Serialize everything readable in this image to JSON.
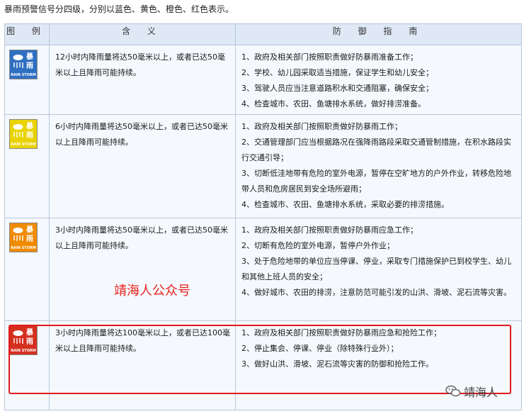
{
  "intro": "暴雨预警信号分四级，分别以蓝色、黄色、橙色、红色表示。",
  "headers": {
    "icon": "图 例",
    "meaning": "含 义",
    "guide": "防 御 指 南"
  },
  "rows": [
    {
      "level": "blue",
      "sign": {
        "chars": "暴雨",
        "en": "RAIN STORM",
        "color": "#2f6fc2"
      },
      "meaning": "12小时内降雨量将达50毫米以上，或者已达50毫米以上且降雨可能持续。",
      "guide": [
        "1、政府及相关部门按照职责做好防暴雨准备工作；",
        "2、学校、幼儿园采取适当措施，保证学生和幼儿安全；",
        "3、驾驶人员应当注意道路积水和交通阻塞，确保安全；",
        "4、检查城市、农田、鱼塘排水系统，做好排涝准备。"
      ]
    },
    {
      "level": "yellow",
      "sign": {
        "chars": "暴雨",
        "en": "RAIN STORM",
        "color": "#e9d300"
      },
      "meaning": "6小时内降雨量将达50毫米以上，或者已达50毫米以上且降雨可能持续。",
      "guide": [
        "1、政府及相关部门按照职责做好防暴雨工作；",
        "2、交通管理部门应当根据路况在强降雨路段采取交通管制措施，在积水路段实行交通引导；",
        "3、切断低洼地带有危险的室外电源，暂停在空旷地方的户外作业，转移危险地带人员和危房居民到安全场所避雨；",
        "4、检查城市、农田、鱼塘排水系统，采取必要的排涝措施。"
      ]
    },
    {
      "level": "orange",
      "sign": {
        "chars": "暴雨",
        "en": "RAIN STORM",
        "color": "#f08a00"
      },
      "meaning": "3小时内降雨量将达50毫米以上，或者已达50毫米以上且降雨可能持续。",
      "guide": [
        "1、政府及相关部门按照职责做好防暴雨应急工作；",
        "2、切断有危险的室外电源，暂停户外作业；",
        "3、处于危险地带的单位应当停课、停业，采取专门措施保护已到校学生、幼儿和其他上班人员的安全；",
        "4、做好城市、农田的排涝，注意防范可能引发的山洪、滑坡、泥石流等灾害。"
      ]
    },
    {
      "level": "red",
      "sign": {
        "chars": "暴雨",
        "en": "RAIN STORM",
        "color": "#d5301f"
      },
      "meaning": "3小时内降雨量将达100毫米以上，或者已达100毫米以上且降雨可能持续。",
      "guide": [
        "1、政府及相关部门按照职责做好防暴雨应急和抢险工作；",
        "2、停止集会、停课、停业（除特殊行业外）；",
        "3、做好山洪、滑坡、泥石流等灾害的防御和抢险工作。"
      ]
    }
  ],
  "watermark": "靖海人公众号",
  "wechat_label": "靖海人",
  "colors": {
    "highlight": "#e01a1a",
    "header_bg": "#dfe8f5",
    "cell_bg": "#f5f8fd"
  }
}
